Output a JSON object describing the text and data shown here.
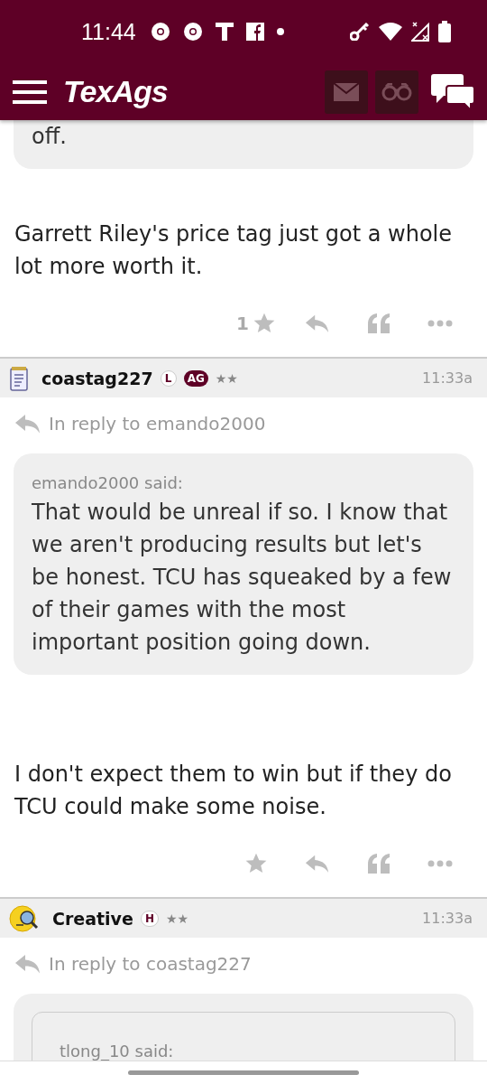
{
  "status_bar": {
    "time": "11:44"
  },
  "app_bar": {
    "logo": "TexAgs"
  },
  "posts": [
    {
      "quote": {
        "text": "off.",
        "nested": false
      },
      "body": "Garrett Riley's price tag just got a whole lot more worth it.",
      "likes": "1"
    },
    {
      "author": "coastag227",
      "avatar": {
        "kind": "notepad"
      },
      "badges": [
        {
          "label": "L",
          "kind": "outline"
        },
        {
          "label": "AG",
          "kind": "filled"
        }
      ],
      "rating": "★★",
      "time": "11:33a",
      "in_reply_to": "In reply to emando2000",
      "quote": {
        "attribution": "emando2000 said:",
        "text": "That would be unreal if so. I know that we aren't producing results but let's be honest. TCU has squeaked by a few of their games with the most important position going down.",
        "nested": false
      },
      "body": "I don't expect them to win but if they do TCU could make some noise."
    },
    {
      "author": "Creative",
      "avatar": {
        "kind": "emoji"
      },
      "badges": [
        {
          "label": "H",
          "kind": "outline"
        }
      ],
      "rating": "★★",
      "time": "11:33a",
      "in_reply_to": "In reply to coastag227",
      "quote": {
        "attribution": "tlong_10 said:",
        "nested": true
      }
    }
  ]
}
